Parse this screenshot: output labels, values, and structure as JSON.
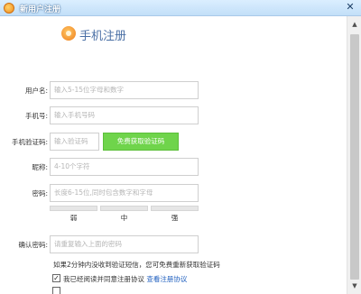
{
  "window": {
    "title": "新用户注册",
    "close_glyph": "✕"
  },
  "heading": "手机注册",
  "form": {
    "username": {
      "label": "用户名:",
      "placeholder": "输入5-15位字母和数字"
    },
    "phone": {
      "label": "手机号:",
      "placeholder": "输入手机号码"
    },
    "code": {
      "label": "手机验证码:",
      "placeholder": "输入验证码",
      "button": "免费获取验证码"
    },
    "nickname": {
      "label": "昵称:",
      "placeholder": "4-10个字符"
    },
    "password": {
      "label": "密码:",
      "placeholder": "长度6-15位,同时包含数字和字母"
    },
    "strength": {
      "levels": [
        "弱",
        "中",
        "强"
      ]
    },
    "confirm": {
      "label": "确认密码:",
      "placeholder": "请重复输入上面的密码"
    }
  },
  "hint": "如果2分钟内没收到验证短信，您可免费重新获取验证码",
  "agreement": {
    "checked_mark": "✓",
    "text": "我已经阅读并同意注册协议",
    "link": "查看注册协议"
  },
  "scrollbar": {
    "up": "▲",
    "down": "▼"
  },
  "colors": {
    "accent_green": "#6fd44b",
    "link_blue": "#1f5fbf",
    "heading_blue": "#4a6fa5"
  }
}
